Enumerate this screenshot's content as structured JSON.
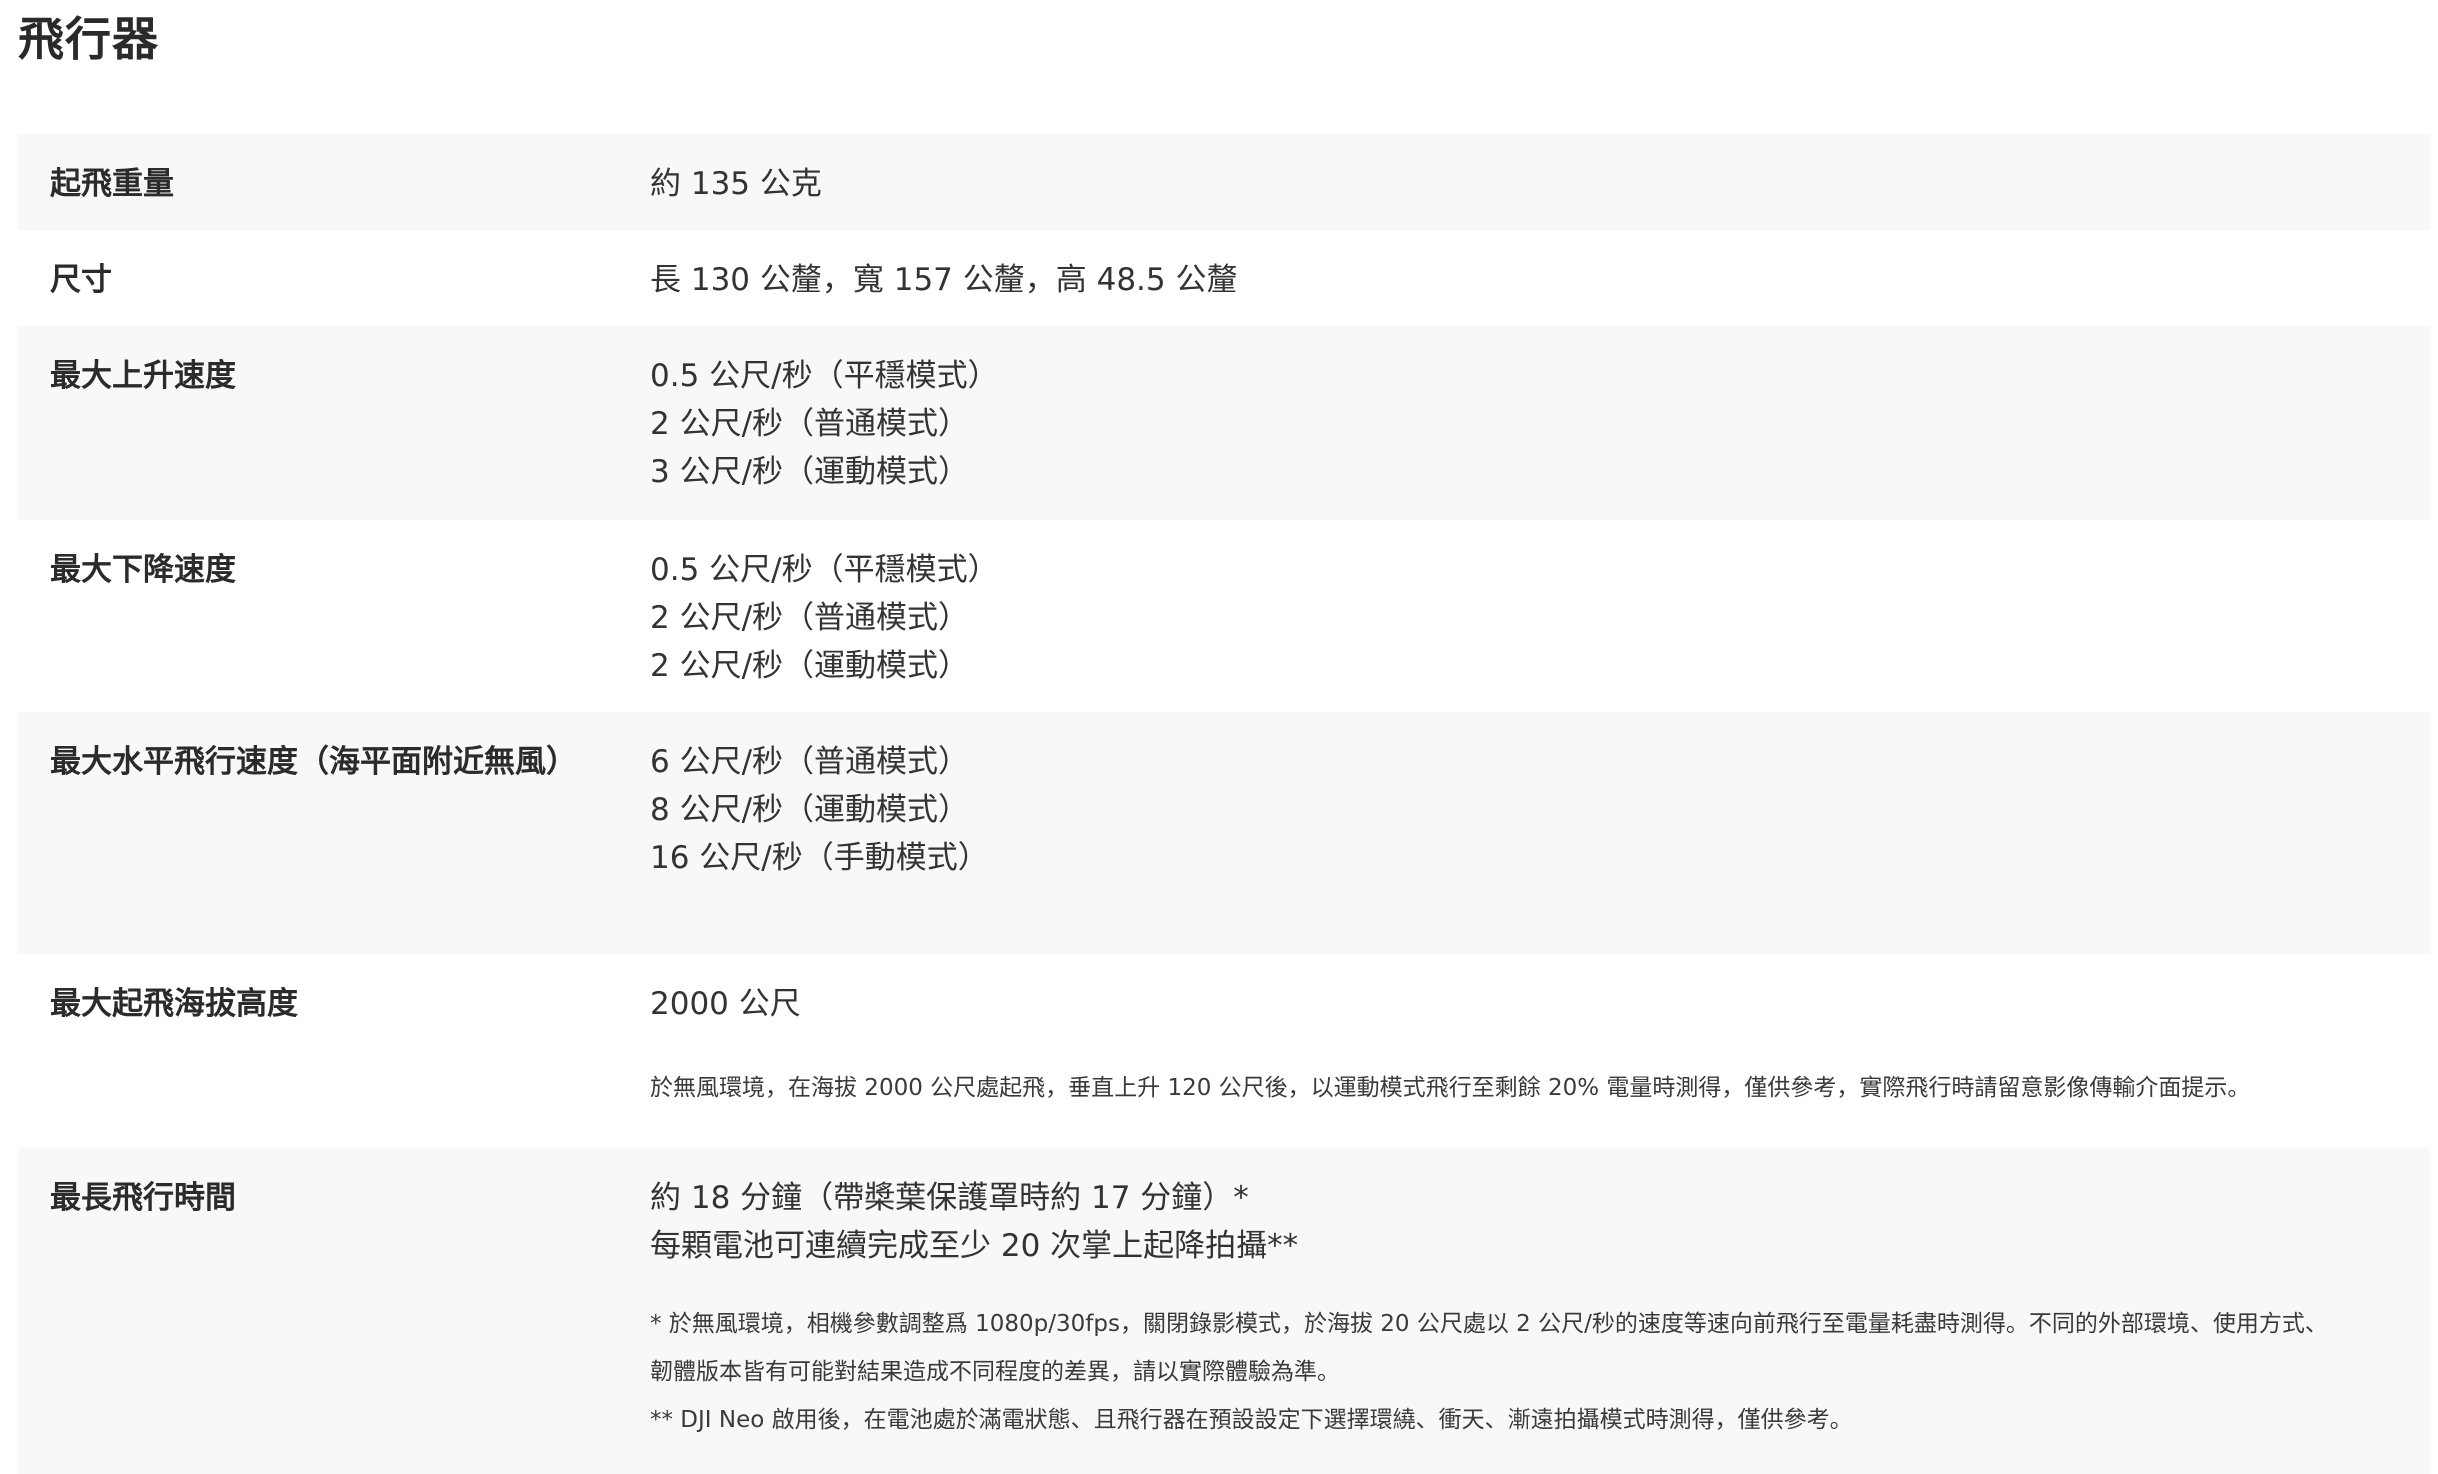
{
  "page": {
    "title": "飛行器"
  },
  "specs": [
    {
      "label": "起飛重量",
      "values": [
        "約 135 公克"
      ],
      "notes": []
    },
    {
      "label": "尺寸",
      "values": [
        "長 130 公釐，寬 157 公釐，高 48.5 公釐"
      ],
      "notes": []
    },
    {
      "label": "最大上升速度",
      "values": [
        "0.5 公尺/秒（平穩模式）",
        "2 公尺/秒（普通模式）",
        "3 公尺/秒（運動模式）"
      ],
      "notes": []
    },
    {
      "label": "最大下降速度",
      "values": [
        "0.5 公尺/秒（平穩模式）",
        "2 公尺/秒（普通模式）",
        "2 公尺/秒（運動模式）"
      ],
      "notes": []
    },
    {
      "label": "最大水平飛行速度（海平面附近無風）",
      "values": [
        "6 公尺/秒（普通模式）",
        "8 公尺/秒（運動模式）",
        "16 公尺/秒（手動模式）"
      ],
      "notes": []
    },
    {
      "label": "最大起飛海拔高度",
      "values": [
        "2000 公尺"
      ],
      "notes": [
        "於無風環境，在海拔 2000 公尺處起飛，垂直上升 120 公尺後，以運動模式飛行至剩餘 20% 電量時測得，僅供參考，實際飛行時請留意影像傳輸介面提示。"
      ]
    },
    {
      "label": "最長飛行時間",
      "values": [
        "約 18 分鐘（帶槳葉保護罩時約 17 分鐘）*",
        "每顆電池可連續完成至少 20 次掌上起降拍攝**"
      ],
      "notes": [
        "* 於無風環境，相機參數調整爲 1080p/30fps，關閉錄影模式，於海拔 20 公尺處以 2 公尺/秒的速度等速向前飛行至電量耗盡時測得。不同的外部環境、使用方式、",
        "韌體版本皆有可能對結果造成不同程度的差異，請以實際體驗為準。",
        "** DJI Neo 啟用後，在電池處於滿電狀態、且飛行器在預設設定下選擇環繞、衝天、漸遠拍攝模式時測得，僅供參考。"
      ]
    }
  ]
}
